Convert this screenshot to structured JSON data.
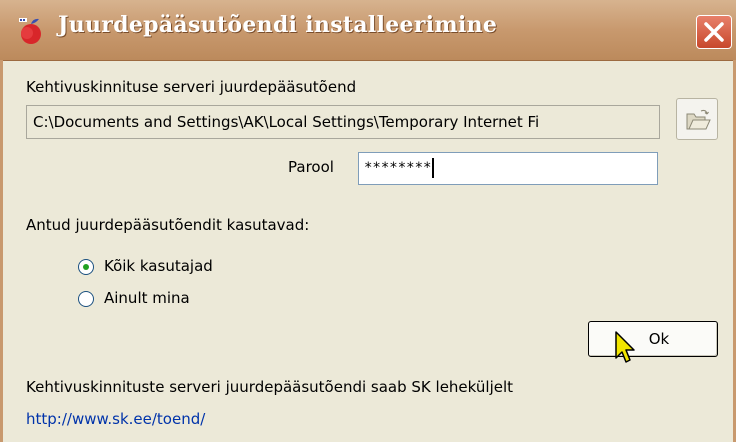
{
  "window": {
    "title": "Juurdepääsutõendi installeerimine",
    "app_icon": "red-apple-icon",
    "close_icon": "close-x-icon"
  },
  "certificate": {
    "label": "Kehtivuskinnituse serveri juurdepääsutõend",
    "path_value": "C:\\Documents and Settings\\AK\\Local Settings\\Temporary Internet Fi",
    "browse_icon": "open-folder-icon"
  },
  "password": {
    "label": "Parool",
    "value": "********"
  },
  "users": {
    "label": "Antud juurdepääsutõendit kasutavad:",
    "options": [
      {
        "label": "Kõik kasutajad",
        "selected": true
      },
      {
        "label": "Ainult mina",
        "selected": false
      }
    ]
  },
  "ok_button": {
    "label": "Ok"
  },
  "footer": {
    "info_text": "Kehtivuskinnituste serveri juurdepääsutõendi saab SK leheküljelt",
    "link_text": "http://www.sk.ee/toend/"
  },
  "colors": {
    "titlebar": "#c8996e",
    "background": "#ece9d8",
    "close_button": "#d45a3c",
    "link": "#0033aa",
    "radio_dot": "#21a121"
  }
}
